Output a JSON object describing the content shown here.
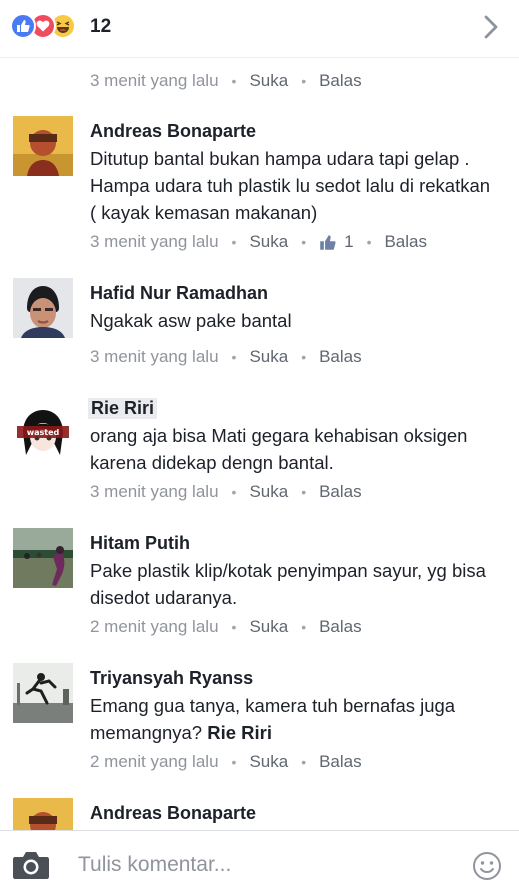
{
  "reactions": {
    "icons": [
      "like-icon",
      "love-icon",
      "haha-icon"
    ],
    "count": "12"
  },
  "first_meta": {
    "time": "3 menit yang lalu",
    "like": "Suka",
    "reply": "Balas"
  },
  "comments": [
    {
      "author": "Andreas Bonaparte",
      "text": "Ditutup bantal bukan hampa udara tapi gelap . Hampa udara tuh plastik lu sedot lalu di rekatkan ( kayak kemasan makanan)",
      "time": "3 menit yang lalu",
      "like": "Suka",
      "like_count": "1",
      "reply": "Balas"
    },
    {
      "author": "Hafid Nur Ramadhan",
      "text": "Ngakak asw pake bantal",
      "time": "3 menit yang lalu",
      "like": "Suka",
      "reply": "Balas"
    },
    {
      "author": "Rie Riri",
      "text": "orang aja bisa Mati gegara kehabisan oksigen karena didekap dengn bantal.",
      "time": "3 menit yang lalu",
      "like": "Suka",
      "reply": "Balas",
      "avatar_badge": "wasted"
    },
    {
      "author": "Hitam Putih",
      "text": "Pake plastik klip/kotak penyimpan sayur, yg bisa disedot udaranya.",
      "time": "2 menit yang lalu",
      "like": "Suka",
      "reply": "Balas"
    },
    {
      "author": "Triyansyah Ryanss",
      "text": "Emang gua tanya, kamera tuh bernafas juga memangnya?",
      "mention": "Rie Riri",
      "time": "2 menit yang lalu",
      "like": "Suka",
      "reply": "Balas"
    },
    {
      "author": "Andreas Bonaparte"
    }
  ],
  "composer": {
    "placeholder": "Tulis komentar..."
  },
  "colors": {
    "meta_gray": "#90949c",
    "text": "#1d2129",
    "like_blue": "#4b7bf3",
    "love_red": "#f04c5f",
    "haha_yellow": "#f7c945"
  }
}
